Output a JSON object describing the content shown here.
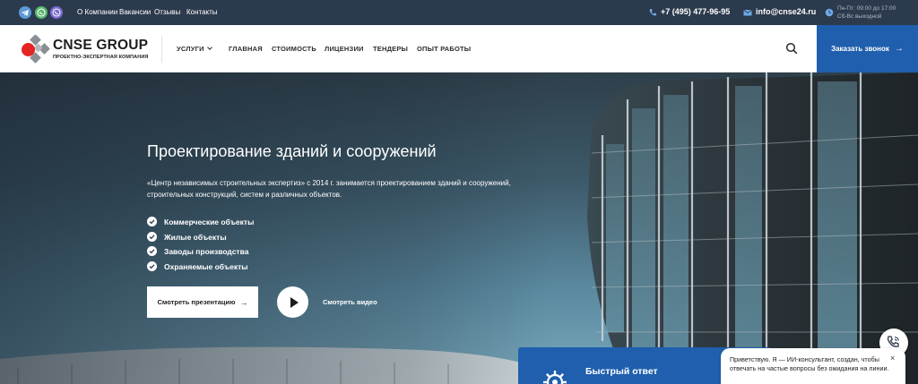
{
  "topbar": {
    "social_icons": [
      "telegram-icon",
      "whatsapp-icon",
      "viber-icon"
    ],
    "links": [
      "О Компании",
      "Вакансии",
      "Отзывы",
      "Контакты"
    ],
    "phone": "+7 (495) 477-96-95",
    "email": "info@cnse24.ru",
    "hours_line1": "Пн-Пт: 09:00 до 17:00",
    "hours_line2": "Сб-Вс выходной",
    "bg_color": "#2c3a4d"
  },
  "header": {
    "logo_title": "CNSE GROUP",
    "logo_subtitle": "ПРОЕКТНО-ЭКСПЕРТНАЯ КОМПАНИЯ",
    "nav": [
      "УСЛУГИ",
      "ГЛАВНАЯ",
      "СТОИМОСТЬ",
      "ЛИЦЕНЗИИ",
      "ТЕНДЕРЫ",
      "ОПЫТ РАБОТЫ"
    ],
    "cta_label": "Заказать звонок",
    "accent_color": "#1f5fae"
  },
  "hero": {
    "title": "Проектирование зданий и сооружений",
    "description": "«Центр независимых строительных экспертиз» с 2014 г. занимается проектированием зданий и сооружений, строительных конструкций, систем и различных объектов.",
    "checklist": [
      "Коммерческие объекты",
      "Жилые объекты",
      "Заводы производства",
      "Охраняемые объекты"
    ],
    "presentation_label": "Смотреть презентацию",
    "video_label": "Смотреть видео"
  },
  "quick_answer": {
    "label": "Быстрый ответ"
  },
  "chat": {
    "message": "Приветствую. Я — ИИ-консультант, создан, чтобы отвечать на частые вопросы без ожидания на линии.",
    "close": "×"
  }
}
